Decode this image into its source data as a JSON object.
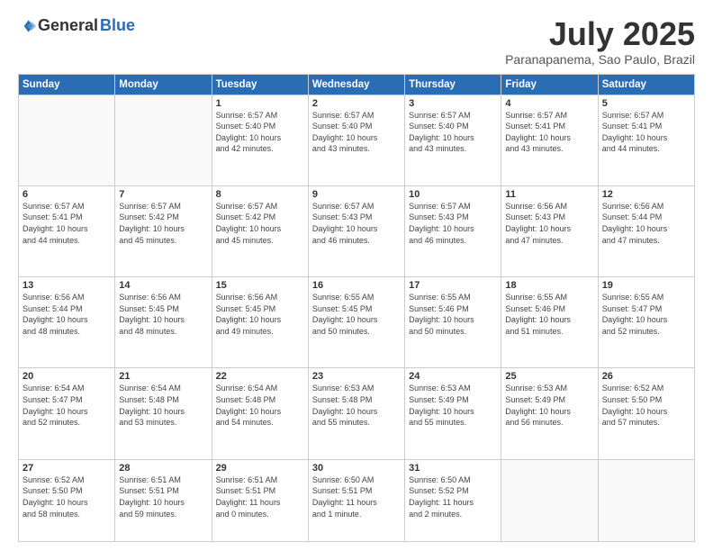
{
  "header": {
    "logo_general": "General",
    "logo_blue": "Blue",
    "month_title": "July 2025",
    "subtitle": "Paranapanema, Sao Paulo, Brazil"
  },
  "weekdays": [
    "Sunday",
    "Monday",
    "Tuesday",
    "Wednesday",
    "Thursday",
    "Friday",
    "Saturday"
  ],
  "weeks": [
    [
      {
        "day": "",
        "info": ""
      },
      {
        "day": "",
        "info": ""
      },
      {
        "day": "1",
        "info": "Sunrise: 6:57 AM\nSunset: 5:40 PM\nDaylight: 10 hours\nand 42 minutes."
      },
      {
        "day": "2",
        "info": "Sunrise: 6:57 AM\nSunset: 5:40 PM\nDaylight: 10 hours\nand 43 minutes."
      },
      {
        "day": "3",
        "info": "Sunrise: 6:57 AM\nSunset: 5:40 PM\nDaylight: 10 hours\nand 43 minutes."
      },
      {
        "day": "4",
        "info": "Sunrise: 6:57 AM\nSunset: 5:41 PM\nDaylight: 10 hours\nand 43 minutes."
      },
      {
        "day": "5",
        "info": "Sunrise: 6:57 AM\nSunset: 5:41 PM\nDaylight: 10 hours\nand 44 minutes."
      }
    ],
    [
      {
        "day": "6",
        "info": "Sunrise: 6:57 AM\nSunset: 5:41 PM\nDaylight: 10 hours\nand 44 minutes."
      },
      {
        "day": "7",
        "info": "Sunrise: 6:57 AM\nSunset: 5:42 PM\nDaylight: 10 hours\nand 45 minutes."
      },
      {
        "day": "8",
        "info": "Sunrise: 6:57 AM\nSunset: 5:42 PM\nDaylight: 10 hours\nand 45 minutes."
      },
      {
        "day": "9",
        "info": "Sunrise: 6:57 AM\nSunset: 5:43 PM\nDaylight: 10 hours\nand 46 minutes."
      },
      {
        "day": "10",
        "info": "Sunrise: 6:57 AM\nSunset: 5:43 PM\nDaylight: 10 hours\nand 46 minutes."
      },
      {
        "day": "11",
        "info": "Sunrise: 6:56 AM\nSunset: 5:43 PM\nDaylight: 10 hours\nand 47 minutes."
      },
      {
        "day": "12",
        "info": "Sunrise: 6:56 AM\nSunset: 5:44 PM\nDaylight: 10 hours\nand 47 minutes."
      }
    ],
    [
      {
        "day": "13",
        "info": "Sunrise: 6:56 AM\nSunset: 5:44 PM\nDaylight: 10 hours\nand 48 minutes."
      },
      {
        "day": "14",
        "info": "Sunrise: 6:56 AM\nSunset: 5:45 PM\nDaylight: 10 hours\nand 48 minutes."
      },
      {
        "day": "15",
        "info": "Sunrise: 6:56 AM\nSunset: 5:45 PM\nDaylight: 10 hours\nand 49 minutes."
      },
      {
        "day": "16",
        "info": "Sunrise: 6:55 AM\nSunset: 5:45 PM\nDaylight: 10 hours\nand 50 minutes."
      },
      {
        "day": "17",
        "info": "Sunrise: 6:55 AM\nSunset: 5:46 PM\nDaylight: 10 hours\nand 50 minutes."
      },
      {
        "day": "18",
        "info": "Sunrise: 6:55 AM\nSunset: 5:46 PM\nDaylight: 10 hours\nand 51 minutes."
      },
      {
        "day": "19",
        "info": "Sunrise: 6:55 AM\nSunset: 5:47 PM\nDaylight: 10 hours\nand 52 minutes."
      }
    ],
    [
      {
        "day": "20",
        "info": "Sunrise: 6:54 AM\nSunset: 5:47 PM\nDaylight: 10 hours\nand 52 minutes."
      },
      {
        "day": "21",
        "info": "Sunrise: 6:54 AM\nSunset: 5:48 PM\nDaylight: 10 hours\nand 53 minutes."
      },
      {
        "day": "22",
        "info": "Sunrise: 6:54 AM\nSunset: 5:48 PM\nDaylight: 10 hours\nand 54 minutes."
      },
      {
        "day": "23",
        "info": "Sunrise: 6:53 AM\nSunset: 5:48 PM\nDaylight: 10 hours\nand 55 minutes."
      },
      {
        "day": "24",
        "info": "Sunrise: 6:53 AM\nSunset: 5:49 PM\nDaylight: 10 hours\nand 55 minutes."
      },
      {
        "day": "25",
        "info": "Sunrise: 6:53 AM\nSunset: 5:49 PM\nDaylight: 10 hours\nand 56 minutes."
      },
      {
        "day": "26",
        "info": "Sunrise: 6:52 AM\nSunset: 5:50 PM\nDaylight: 10 hours\nand 57 minutes."
      }
    ],
    [
      {
        "day": "27",
        "info": "Sunrise: 6:52 AM\nSunset: 5:50 PM\nDaylight: 10 hours\nand 58 minutes."
      },
      {
        "day": "28",
        "info": "Sunrise: 6:51 AM\nSunset: 5:51 PM\nDaylight: 10 hours\nand 59 minutes."
      },
      {
        "day": "29",
        "info": "Sunrise: 6:51 AM\nSunset: 5:51 PM\nDaylight: 11 hours\nand 0 minutes."
      },
      {
        "day": "30",
        "info": "Sunrise: 6:50 AM\nSunset: 5:51 PM\nDaylight: 11 hours\nand 1 minute."
      },
      {
        "day": "31",
        "info": "Sunrise: 6:50 AM\nSunset: 5:52 PM\nDaylight: 11 hours\nand 2 minutes."
      },
      {
        "day": "",
        "info": ""
      },
      {
        "day": "",
        "info": ""
      }
    ]
  ]
}
